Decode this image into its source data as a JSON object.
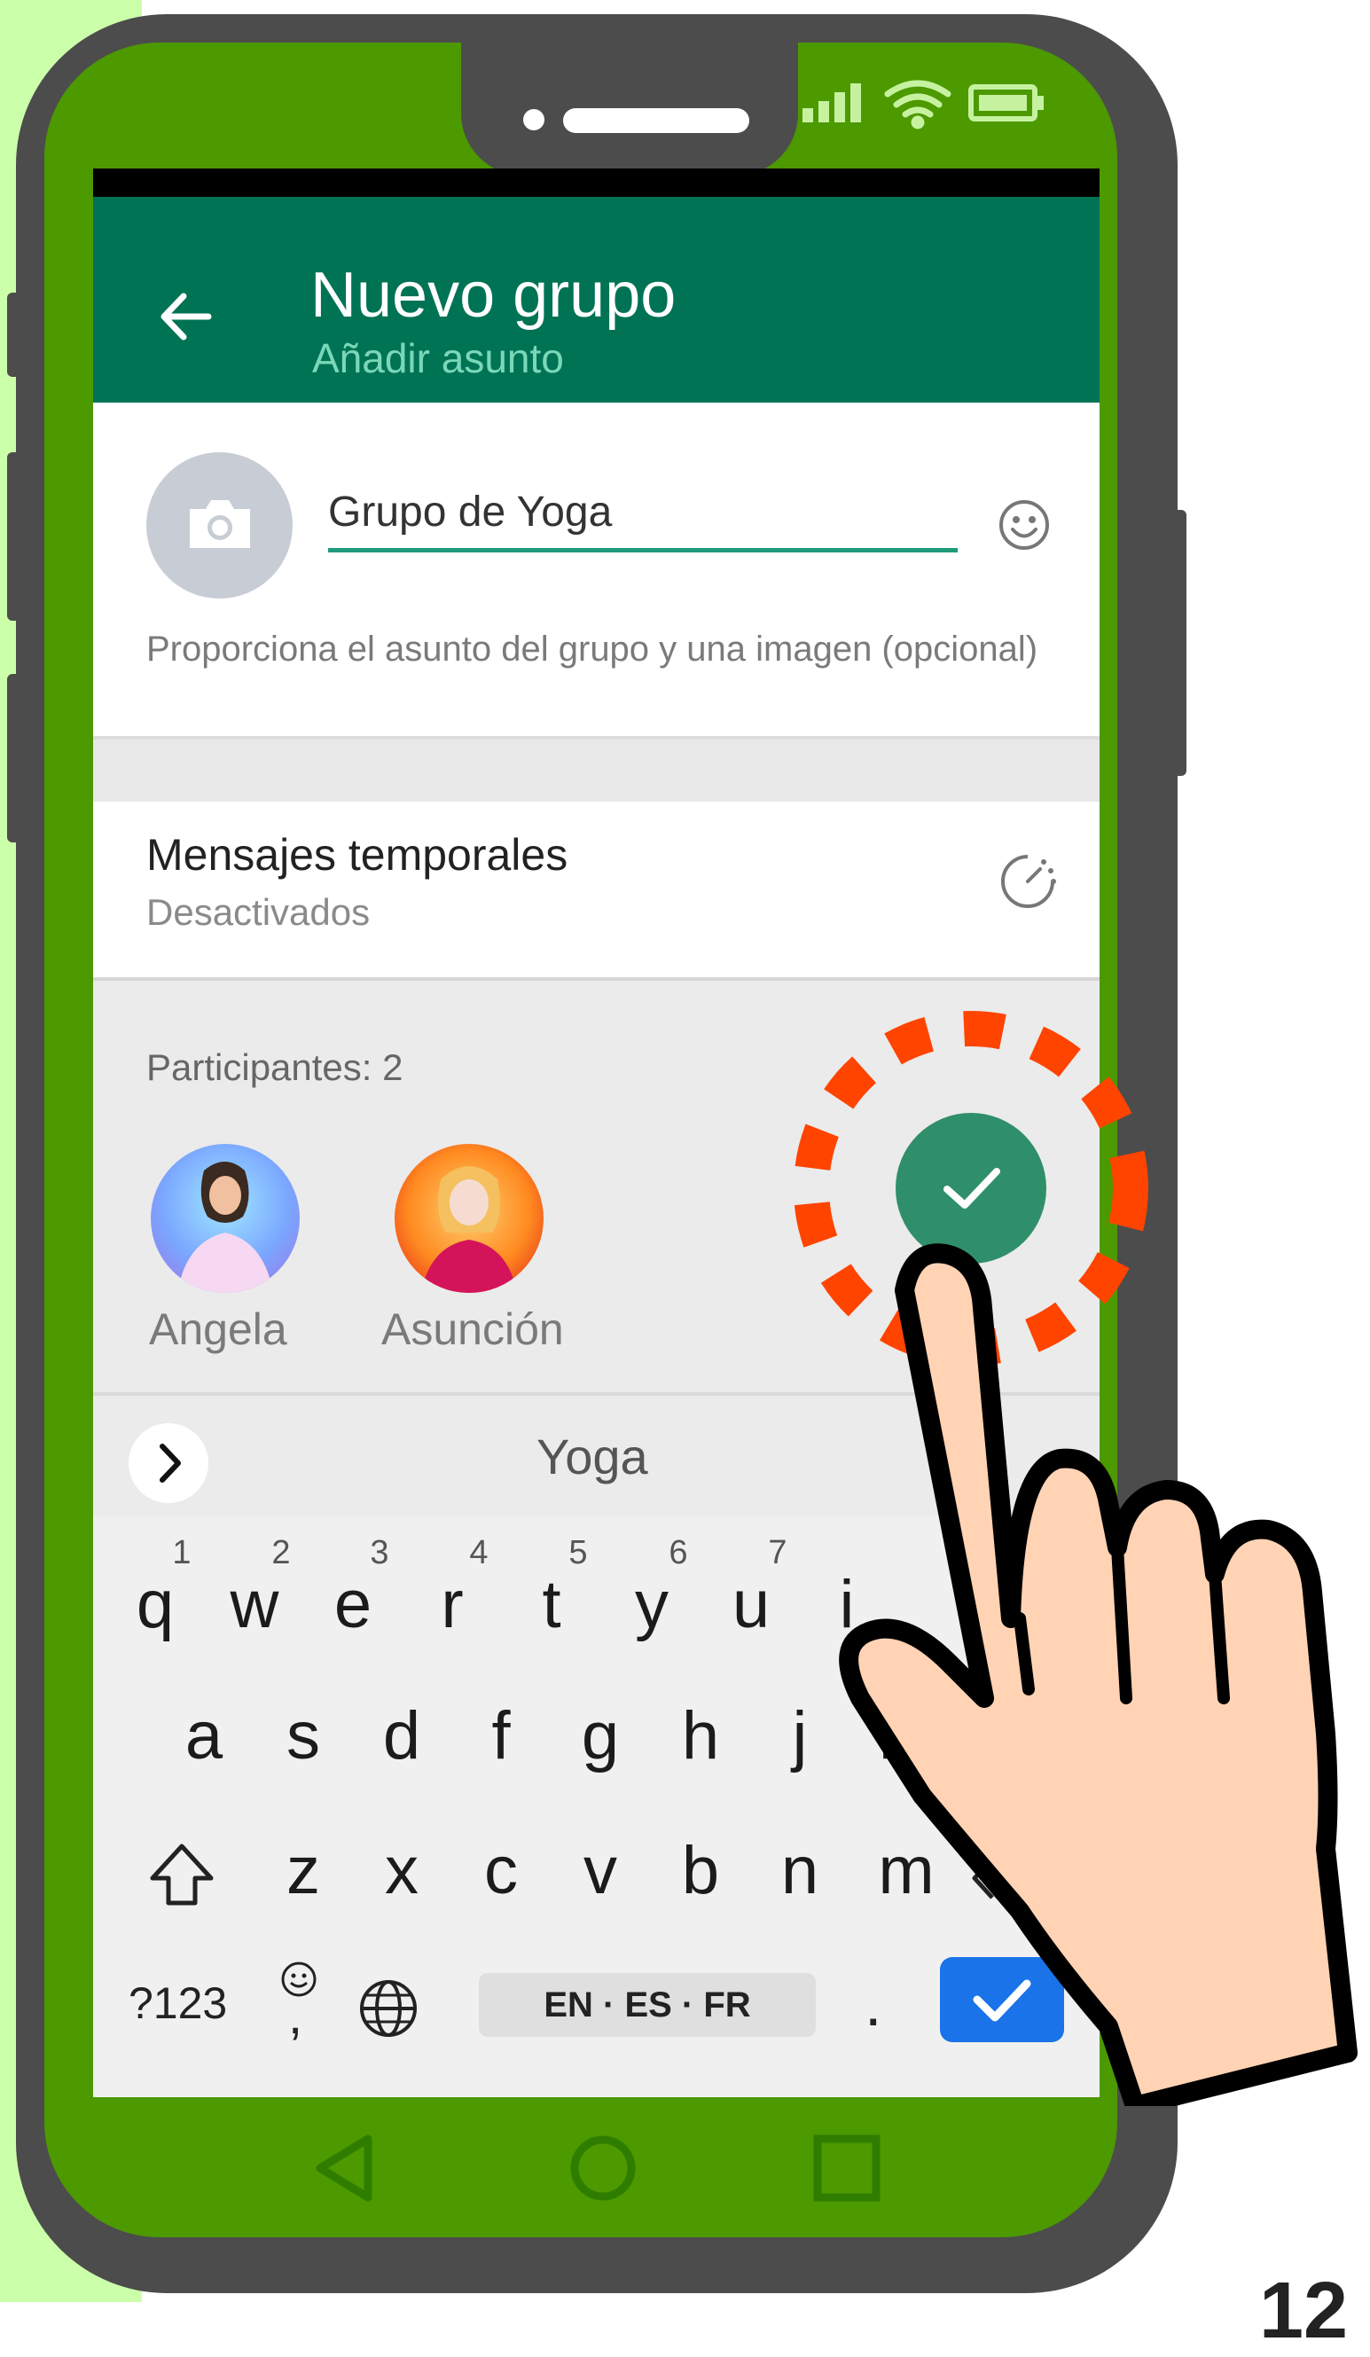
{
  "header": {
    "title": "Nuevo grupo",
    "subtitle": "Añadir asunto"
  },
  "group_form": {
    "subject_value": "Grupo de Yoga",
    "hint": "Proporciona el asunto del grupo y una imagen (opcional)"
  },
  "temporary_messages": {
    "title": "Mensajes temporales",
    "status": "Desactivados"
  },
  "participants": {
    "label": "Participantes: 2",
    "people": [
      {
        "name": "Angela"
      },
      {
        "name": "Asunción"
      }
    ]
  },
  "keyboard": {
    "suggestion": "Yoga",
    "numbers": [
      "1",
      "2",
      "3",
      "4",
      "5",
      "6",
      "7"
    ],
    "row1": [
      "q",
      "w",
      "e",
      "r",
      "t",
      "y",
      "u",
      "i"
    ],
    "row2": [
      "a",
      "s",
      "d",
      "f",
      "g",
      "h",
      "j",
      "k"
    ],
    "row3": [
      "z",
      "x",
      "c",
      "v",
      "b",
      "n",
      "m"
    ],
    "symbols_key": "?123",
    "comma_key": ",",
    "period_key": ".",
    "space_label": "EN · ES · FR"
  },
  "colors": {
    "appbar": "#007355",
    "fab": "#2f8f6a",
    "highlight": "#ff4400",
    "phone_screen_border": "#4c9900",
    "enter_key": "#1a73e8"
  },
  "page_number": "12"
}
